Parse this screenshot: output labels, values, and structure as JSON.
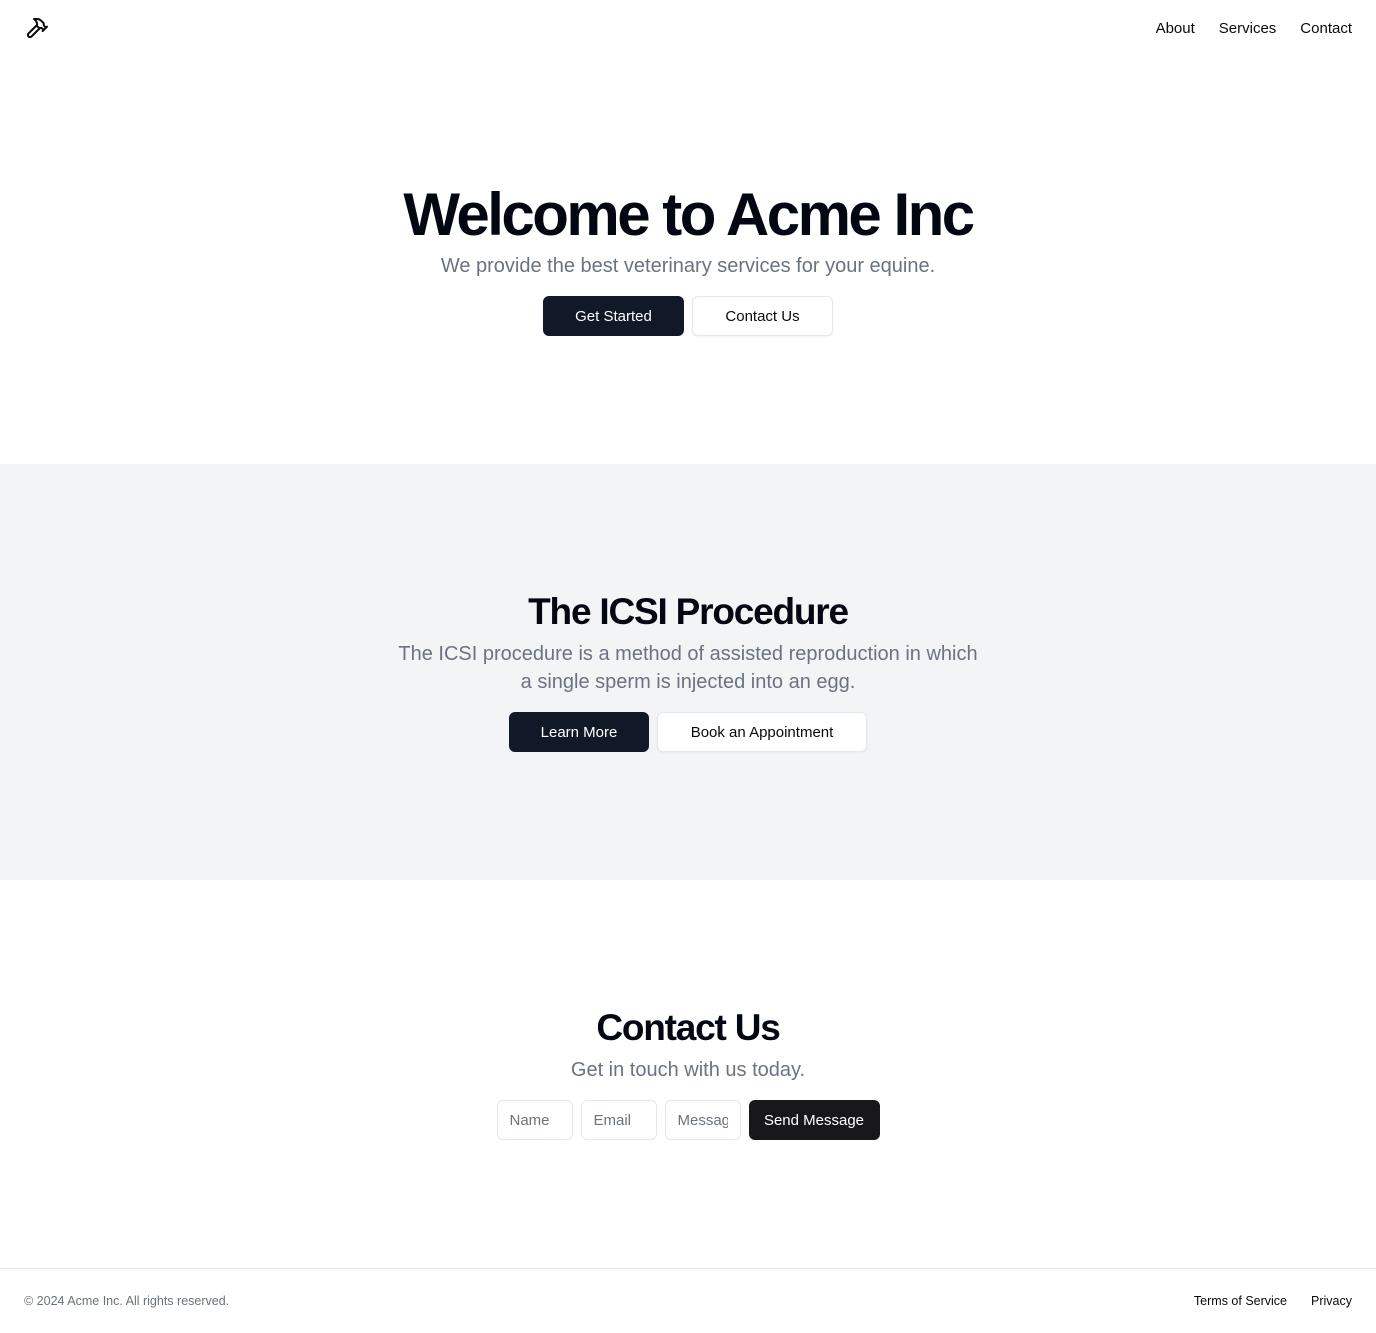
{
  "header": {
    "logo_icon": "hammer-icon",
    "nav": [
      {
        "label": "About"
      },
      {
        "label": "Services"
      },
      {
        "label": "Contact"
      }
    ]
  },
  "hero": {
    "title": "Welcome to Acme Inc",
    "subtitle": "We provide the best veterinary services for your equine.",
    "primary_button": "Get Started",
    "secondary_button": "Contact Us"
  },
  "icsi": {
    "title": "The ICSI Procedure",
    "description": "The ICSI procedure is a method of assisted reproduction in which a single sperm is injected into an egg.",
    "primary_button": "Learn More",
    "secondary_button": "Book an Appointment"
  },
  "contact": {
    "title": "Contact Us",
    "subtitle": "Get in touch with us today.",
    "name_placeholder": "Name",
    "email_placeholder": "Email",
    "message_placeholder": "Message",
    "submit_button": "Send Message"
  },
  "footer": {
    "copyright": "© 2024 Acme Inc. All rights reserved.",
    "links": [
      {
        "label": "Terms of Service"
      },
      {
        "label": "Privacy"
      }
    ]
  },
  "colors": {
    "primary_button": "#111827",
    "section_alt_bg": "#f3f4f6",
    "muted_text": "#6b7280",
    "border": "#e5e7eb"
  }
}
